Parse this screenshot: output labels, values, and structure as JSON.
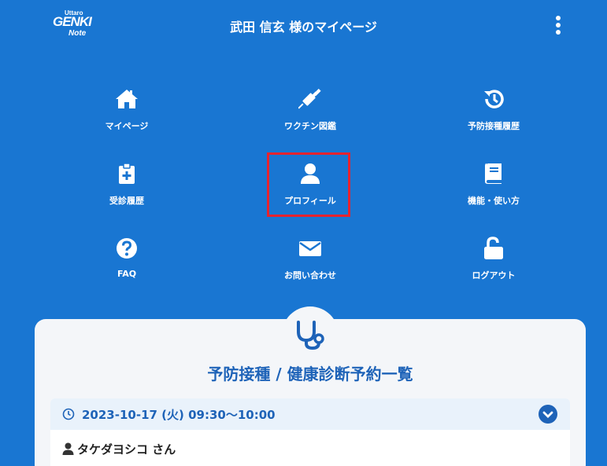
{
  "header": {
    "logo": {
      "line1": "Uttaro",
      "line2": "GENKI",
      "line3": "Note"
    },
    "title": "武田 信玄 様のマイページ",
    "menu_icon": "more-vertical-icon"
  },
  "menu": {
    "items": [
      {
        "label": "マイページ",
        "icon": "home-icon"
      },
      {
        "label": "ワクチン図鑑",
        "icon": "syringe-icon"
      },
      {
        "label": "予防接種履歴",
        "icon": "history-icon"
      },
      {
        "label": "受診履歴",
        "icon": "clipboard-medical-icon"
      },
      {
        "label": "プロフィール",
        "icon": "user-icon",
        "highlighted": true
      },
      {
        "label": "機能・使い方",
        "icon": "book-icon"
      },
      {
        "label": "FAQ",
        "icon": "question-circle-icon"
      },
      {
        "label": "お問い合わせ",
        "icon": "envelope-icon"
      },
      {
        "label": "ログアウト",
        "icon": "unlock-icon"
      }
    ]
  },
  "card": {
    "icon": "stethoscope-icon",
    "title": "予防接種 / 健康診断予約一覧",
    "appointment": {
      "datetime": "2023-10-17 (火) 09:30〜10:00",
      "name": "タケダヨシコ さん",
      "icons": {
        "time": "clock-icon",
        "person": "user-icon",
        "toggle": "chevron-down-circle-icon"
      }
    }
  },
  "colors": {
    "background": "#1976d2",
    "accent": "#1e63b8",
    "highlight": "#e8232e",
    "card": "#f4f6f9"
  }
}
